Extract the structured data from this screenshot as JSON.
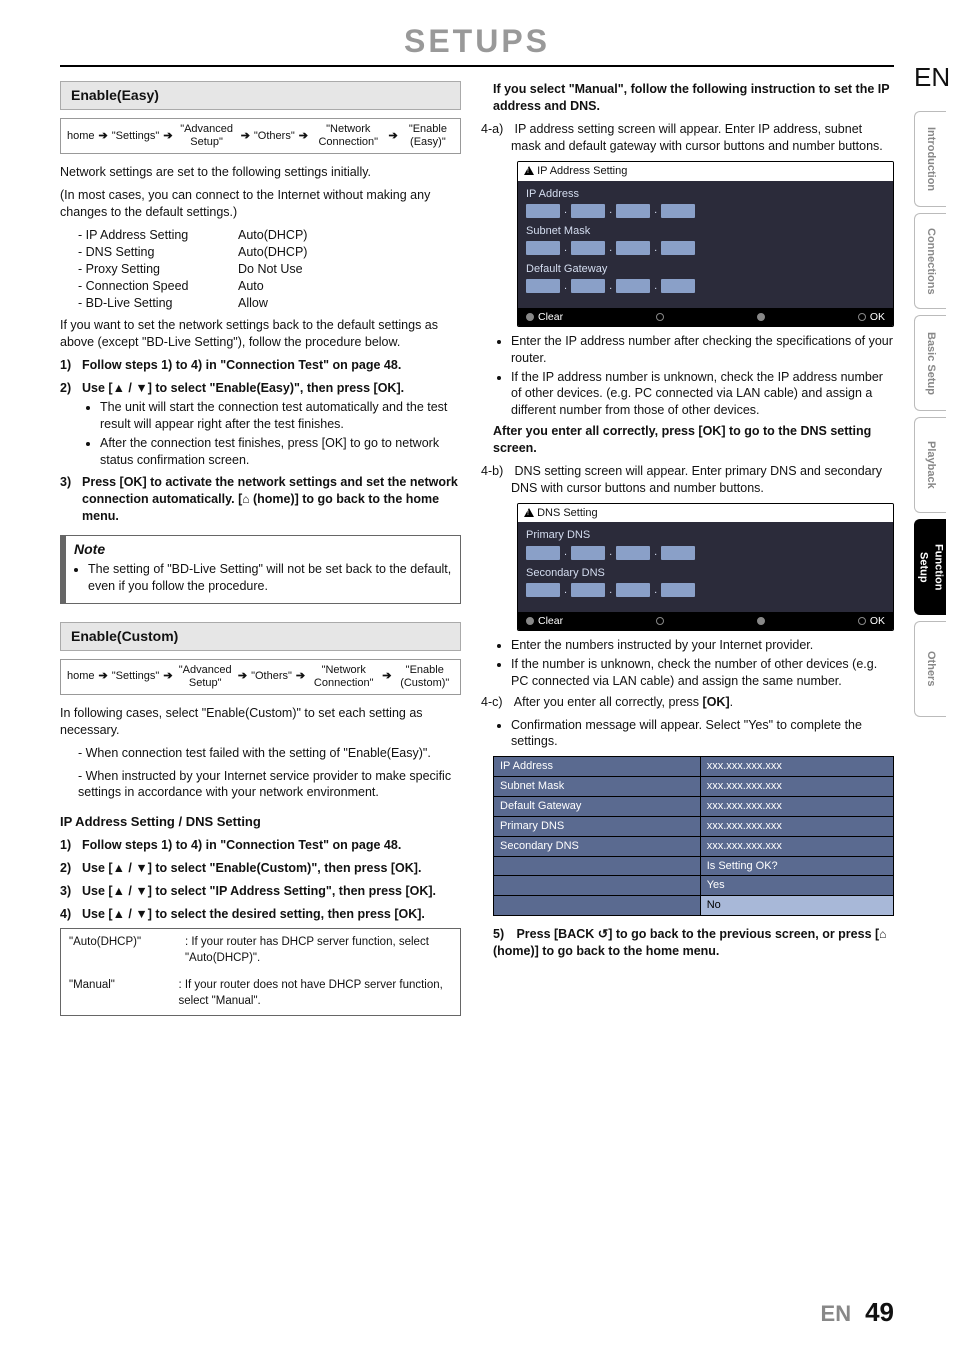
{
  "page_title": "SETUPS",
  "lang_code": "EN",
  "page_number": "49",
  "tabs": [
    "Introduction",
    "Connections",
    "Basic Setup",
    "Playback",
    "Function Setup",
    "Others"
  ],
  "active_tab_index": 4,
  "left": {
    "easy": {
      "heading": "Enable(Easy)",
      "crumb": [
        "home",
        "\"Settings\"",
        "\"Advanced Setup\"",
        "\"Others\"",
        "\"Network Connection\"",
        "\"Enable (Easy)\""
      ],
      "p1": "Network settings are set to the following settings initially.",
      "p2": "(In most cases, you can connect to the Internet without making any changes to the default settings.)",
      "defaults": [
        {
          "k": "- IP Address Setting",
          "v": "Auto(DHCP)"
        },
        {
          "k": "- DNS Setting",
          "v": "Auto(DHCP)"
        },
        {
          "k": "- Proxy Setting",
          "v": "Do Not Use"
        },
        {
          "k": "- Connection Speed",
          "v": "Auto"
        },
        {
          "k": "- BD-Live Setting",
          "v": "Allow"
        }
      ],
      "p3": "If you want to set the network settings back to the default settings as above (except \"BD-Live Setting\"), follow the procedure below.",
      "steps": [
        {
          "t": "Follow steps 1) to 4) in \"Connection Test\" on page 48."
        },
        {
          "t": "Use [▲ / ▼] to select \"Enable(Easy)\", then press [OK].",
          "bul": [
            "The unit will start the connection test automatically and the test result will appear right after the test finishes.",
            "After the connection test finishes, press [OK] to go to network status confirmation screen."
          ]
        },
        {
          "t": "Press [OK] to activate the network settings and set the network connection automatically. [  (home)] to go back to the home menu."
        }
      ],
      "note_title": "Note",
      "note_item": "The setting of \"BD-Live Setting\" will not be set back to the default, even if you follow the procedure."
    },
    "custom": {
      "heading": "Enable(Custom)",
      "crumb": [
        "home",
        "\"Settings\"",
        "\"Advanced Setup\"",
        "\"Others\"",
        "\"Network Connection\"",
        "\"Enable (Custom)\""
      ],
      "p1": "In following cases, select \"Enable(Custom)\" to set each setting as necessary.",
      "dash": [
        "- When connection test failed with the setting of \"Enable(Easy)\".",
        "- When instructed by your Internet service provider to make specific settings in accordance with your network environment."
      ],
      "sub": "IP Address Setting / DNS Setting",
      "steps": [
        {
          "t": "Follow steps 1) to 4) in \"Connection Test\" on page 48."
        },
        {
          "t": "Use [▲ / ▼] to select \"Enable(Custom)\", then press [OK]."
        },
        {
          "t": "Use [▲ / ▼] to select \"IP Address Setting\", then press [OK]."
        },
        {
          "t": "Use [▲ / ▼] to select the desired setting, then press [OK]."
        }
      ],
      "opts": [
        {
          "k": "\"Auto(DHCP)\"",
          "v": ": If your router has DHCP server function, select \"Auto(DHCP)\"."
        },
        {
          "k": "\"Manual\"",
          "v": ": If your router does not have DHCP server function, select \"Manual\"."
        }
      ]
    }
  },
  "right": {
    "manual_head": "If you select \"Manual\", follow the following instruction to set the IP address and DNS.",
    "s4a": "IP address setting screen will appear. Enter IP address, subnet mask and default gateway with cursor buttons and number buttons.",
    "s4a_label": "4-a)",
    "ip_screen": {
      "title": "IP Address Setting",
      "rows": [
        "IP Address",
        "Subnet Mask",
        "Default Gateway"
      ],
      "clear": "Clear",
      "ok": "OK"
    },
    "ip_bul": [
      "Enter the IP address number after checking the specifications of your router.",
      "If the IP address number is unknown, check the IP address number of other devices. (e.g. PC connected via LAN cable) and assign a different number from those of other devices."
    ],
    "after_ip": "After you enter all correctly, press [OK] to go to the DNS setting screen.",
    "s4b_label": "4-b)",
    "s4b": "DNS setting screen will appear. Enter primary DNS and secondary DNS with cursor buttons and number buttons.",
    "dns_screen": {
      "title": "DNS Setting",
      "rows": [
        "Primary DNS",
        "Secondary DNS"
      ],
      "clear": "Clear",
      "ok": "OK"
    },
    "dns_bul": [
      "Enter the numbers instructed by your Internet provider.",
      "If the number is unknown, check the number of other devices (e.g. PC connected via LAN cable) and assign the same number."
    ],
    "s4c_label": "4-c)",
    "s4c": "After you enter all correctly, press [OK].",
    "s4c_bul": [
      "Confirmation message will appear. Select \"Yes\" to complete the settings."
    ],
    "confirm": [
      [
        "IP Address",
        "xxx.xxx.xxx.xxx"
      ],
      [
        "Subnet Mask",
        "xxx.xxx.xxx.xxx"
      ],
      [
        "Default Gateway",
        "xxx.xxx.xxx.xxx"
      ],
      [
        "Primary DNS",
        "xxx.xxx.xxx.xxx"
      ],
      [
        "Secondary DNS",
        "xxx.xxx.xxx.xxx"
      ],
      [
        "",
        "Is Setting OK?"
      ],
      [
        "",
        "Yes"
      ],
      [
        "",
        "No"
      ]
    ],
    "step5": "Press [BACK ↺] to go back to the previous screen, or press [  (home)] to go back to the home menu.",
    "step5_n": "5)"
  }
}
